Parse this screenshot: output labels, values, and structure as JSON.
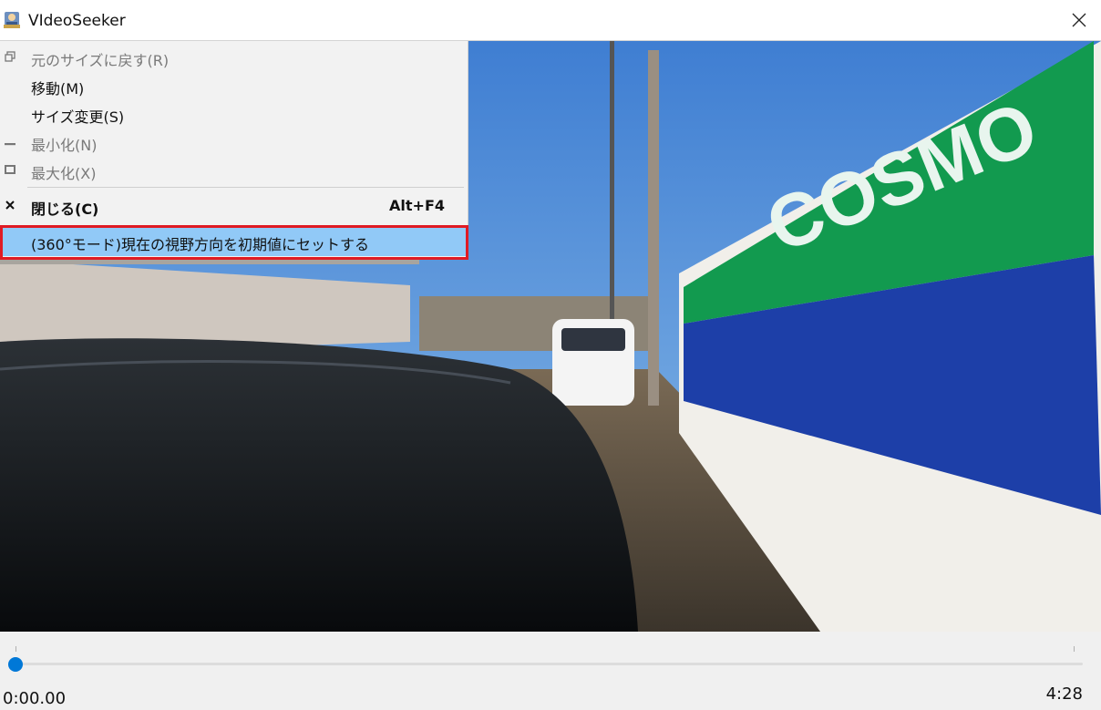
{
  "window": {
    "title": "VIdeoSeeker"
  },
  "menu": {
    "items": [
      {
        "label": "元のサイズに戻す(R)",
        "disabled": true,
        "icon": "restore-icon"
      },
      {
        "label": "移動(M)",
        "disabled": false
      },
      {
        "label": "サイズ変更(S)",
        "disabled": false
      },
      {
        "label": "最小化(N)",
        "disabled": true,
        "icon": "minimize-icon"
      },
      {
        "label": "最大化(X)",
        "disabled": true,
        "icon": "maximize-icon"
      },
      {
        "label": "閉じる(C)",
        "accelerator": "Alt+F4",
        "disabled": false,
        "icon": "close-icon"
      },
      {
        "label": "(360°モード)現在の視野方向を初期値にセットする",
        "highlighted": true
      }
    ]
  },
  "video": {
    "sign_text": "COSMO",
    "colors": {
      "sky": "#4b86d8",
      "sign_green": "#129a4f",
      "sign_blue": "#1d3fa8"
    }
  },
  "player": {
    "current_time": "0:00.00",
    "total_time": "4:28",
    "progress": 0.0,
    "accent": "#0078d7"
  }
}
